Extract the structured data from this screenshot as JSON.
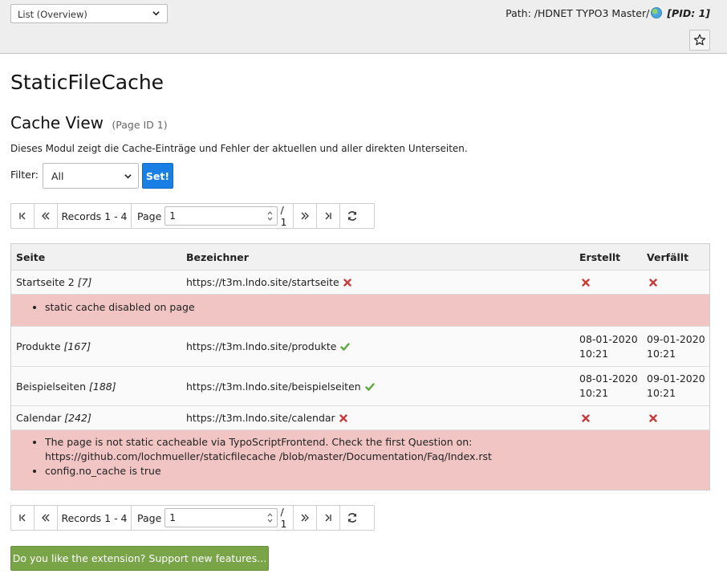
{
  "docheader": {
    "view_select": "List (Overview)",
    "path_prefix": "Path: /HDNET TYPO3 Master/",
    "pid_label": "[PID: 1]"
  },
  "page": {
    "title": "StaticFileCache",
    "subtitle": "Cache View",
    "page_id": "(Page ID 1)",
    "description": "Dieses Modul zeigt die Cache-Einträge und Fehler der aktuellen und aller direkten Unterseiten.",
    "filter_label": "Filter:",
    "filter_value": "All",
    "set_button": "Set!"
  },
  "pagination": {
    "records": "Records 1 - 4",
    "page_label": "Page",
    "page_value": "1",
    "page_total": "/ 1"
  },
  "table": {
    "headers": [
      "Seite",
      "Bezeichner",
      "Erstellt",
      "Verfällt"
    ],
    "rows": [
      {
        "seite": "Startseite 2",
        "uid": "[7]",
        "url": "https://t3m.lndo.site/startseite",
        "status": "error",
        "created": "",
        "expires": "",
        "errors": [
          "static cache disabled on page"
        ]
      },
      {
        "seite": "Produkte",
        "uid": "[167]",
        "url": "https://t3m.lndo.site/produkte",
        "status": "ok",
        "created_date": "08-01-2020",
        "created_time": "10:21",
        "expires_date": "09-01-2020",
        "expires_time": "10:21"
      },
      {
        "seite": "Beispielseiten",
        "uid": "[188]",
        "url": "https://t3m.lndo.site/beispielseiten",
        "status": "ok",
        "created_date": "08-01-2020",
        "created_time": "10:21",
        "expires_date": "09-01-2020",
        "expires_time": "10:21"
      },
      {
        "seite": "Calendar",
        "uid": "[242]",
        "url": "https://t3m.lndo.site/calendar",
        "status": "error",
        "errors": [
          "The page is not static cacheable via TypoScriptFrontend. Check the first Question on: https://github.com/lochmueller/staticfilecache /blob/master/Documentation/Faq/Index.rst",
          "config.no_cache is true"
        ]
      }
    ]
  },
  "support_button": "Do you like the extension? Support new features...",
  "colors": {
    "accent_blue": "#1a7fe4",
    "error_row": "#f2c5c5",
    "success_green": "#5ba83c",
    "error_red": "#c83c3c",
    "support_green": "#79a548"
  },
  "icons": {
    "view_select_chevron": "chevron-down-icon",
    "path_globe": "globe-icon",
    "bookmark": "star-icon",
    "first": "first-page-icon",
    "prev": "previous-page-icon",
    "next": "next-page-icon",
    "last": "last-page-icon",
    "refresh": "refresh-icon",
    "error": "cross-icon",
    "ok": "check-icon"
  }
}
